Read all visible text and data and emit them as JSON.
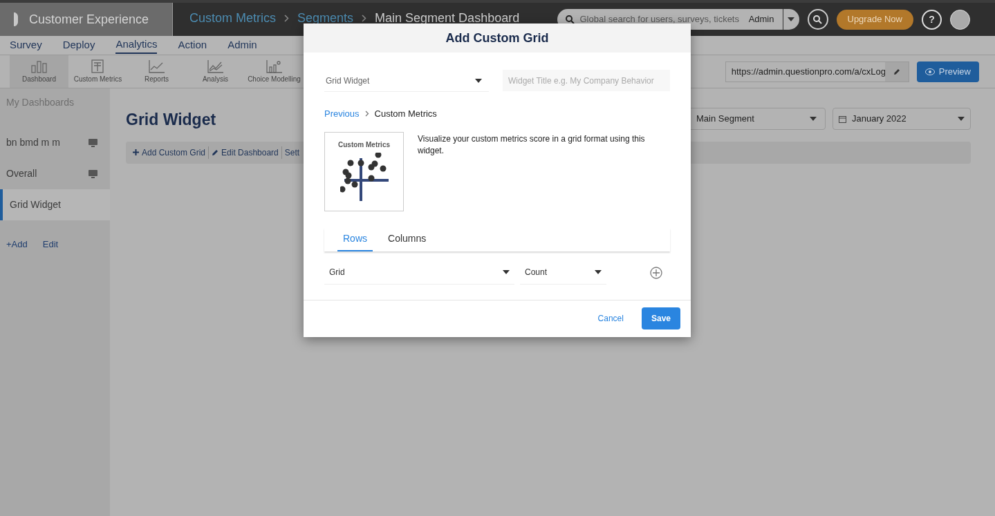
{
  "topbar": {
    "product": "Customer Experience",
    "breadcrumbs": [
      {
        "label": "Custom Metrics",
        "link": true
      },
      {
        "label": "Segments",
        "link": true
      },
      {
        "label": "Main Segment Dashboard",
        "link": false
      }
    ],
    "search": {
      "placeholder": "Global search for users, surveys, tickets",
      "scope": "Admin"
    },
    "upgrade": "Upgrade Now",
    "help": "?"
  },
  "menu": [
    {
      "label": "Survey",
      "selected": false
    },
    {
      "label": "Deploy",
      "selected": false
    },
    {
      "label": "Analytics",
      "selected": true
    },
    {
      "label": "Action",
      "selected": false
    },
    {
      "label": "Admin",
      "selected": false
    }
  ],
  "toolbar": [
    {
      "label": "Dashboard",
      "kind": "bars",
      "selected": true
    },
    {
      "label": "Custom Metrics",
      "kind": "sheet",
      "selected": false
    },
    {
      "label": "Reports",
      "kind": "line",
      "selected": false
    },
    {
      "label": "Analysis",
      "kind": "multiline",
      "selected": false
    },
    {
      "label": "Choice Modelling",
      "kind": "scatter",
      "selected": false
    }
  ],
  "url": "https://admin.questionpro.com/a/cxLog",
  "preview": "Preview",
  "sidebar": {
    "heading": "My Dashboards",
    "items": [
      {
        "label": "bn bmd m m",
        "monitor": true,
        "selected": false
      },
      {
        "label": "Overall",
        "monitor": true,
        "selected": false
      },
      {
        "label": "Grid Widget",
        "monitor": false,
        "selected": true
      }
    ],
    "actions": [
      "+Add",
      "Edit"
    ]
  },
  "main": {
    "title": "Grid Widget",
    "actions": [
      {
        "label": "Add Custom Grid",
        "kind": "plus"
      },
      {
        "label": "Edit Dashboard",
        "kind": "pencil"
      },
      {
        "label": "Sett",
        "kind": "none"
      }
    ],
    "segment": "Main Segment",
    "period": "January 2022"
  },
  "dialog": {
    "title": "Add Custom Grid",
    "widget_type": "Grid Widget",
    "title_field": {
      "placeholder": "Widget Title e.g. My Company Behavior"
    },
    "back": "Previous",
    "crumb": "Custom Metrics",
    "thumbnail_title": "Custom Metrics",
    "description": "Visualize your custom metrics score in a grid format using this widget.",
    "tabs": [
      {
        "label": "Rows",
        "selected": true
      },
      {
        "label": "Columns",
        "selected": false
      }
    ],
    "row_field": "Grid",
    "measure": "Count",
    "cancel": "Cancel",
    "save": "Save"
  }
}
